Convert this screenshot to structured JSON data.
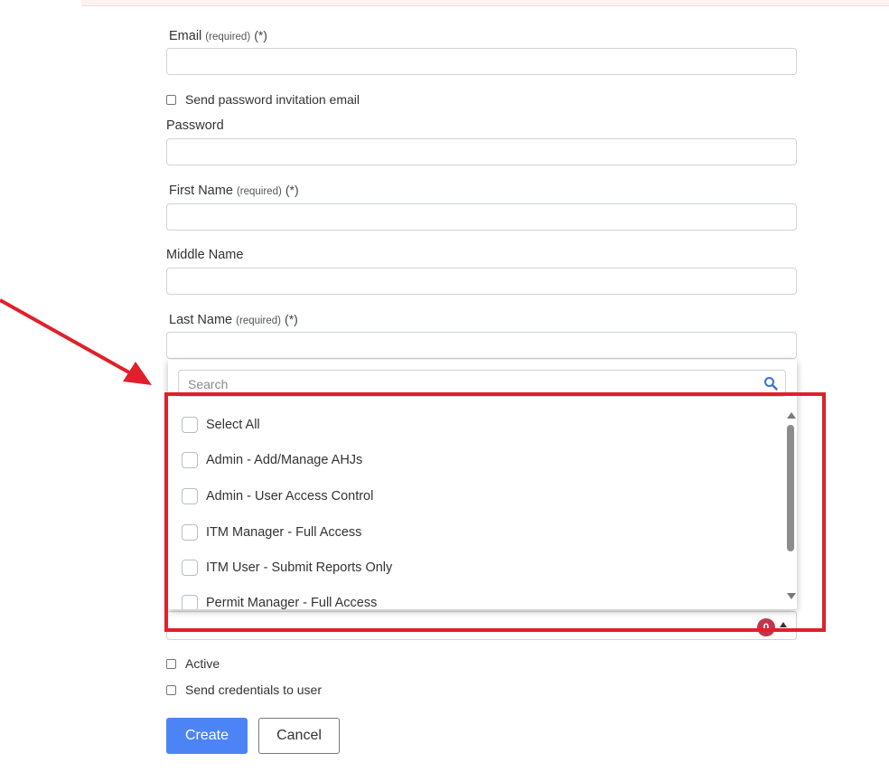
{
  "form": {
    "email": {
      "label": "Email",
      "required_hint": "(required)",
      "required_mark": "(*)",
      "value": ""
    },
    "send_invitation": {
      "label": "Send password invitation email",
      "checked": false
    },
    "password": {
      "label": "Password",
      "value": ""
    },
    "first_name": {
      "label": "First Name",
      "required_hint": "(required)",
      "required_mark": "(*)",
      "value": ""
    },
    "middle_name": {
      "label": "Middle Name",
      "value": ""
    },
    "last_name": {
      "label": "Last Name",
      "required_hint": "(required)",
      "required_mark": "(*)",
      "value": ""
    },
    "roles": {
      "selected_count": "0",
      "dropdown": {
        "search_placeholder": "Search",
        "options": [
          {
            "label": "Select All",
            "checked": false
          },
          {
            "label": "Admin - Add/Manage AHJs",
            "checked": false
          },
          {
            "label": "Admin - User Access Control",
            "checked": false
          },
          {
            "label": "ITM Manager - Full Access",
            "checked": false
          },
          {
            "label": "ITM User - Submit Reports Only",
            "checked": false
          },
          {
            "label": "Permit Manager - Full Access",
            "checked": false
          }
        ]
      }
    },
    "active": {
      "label": "Active",
      "checked": false
    },
    "send_credentials": {
      "label": "Send credentials to user",
      "checked": false
    }
  },
  "actions": {
    "create_label": "Create",
    "cancel_label": "Cancel"
  },
  "colors": {
    "primary": "#4d84f5",
    "annotation": "#e0202a",
    "badge": "#c1364c"
  }
}
